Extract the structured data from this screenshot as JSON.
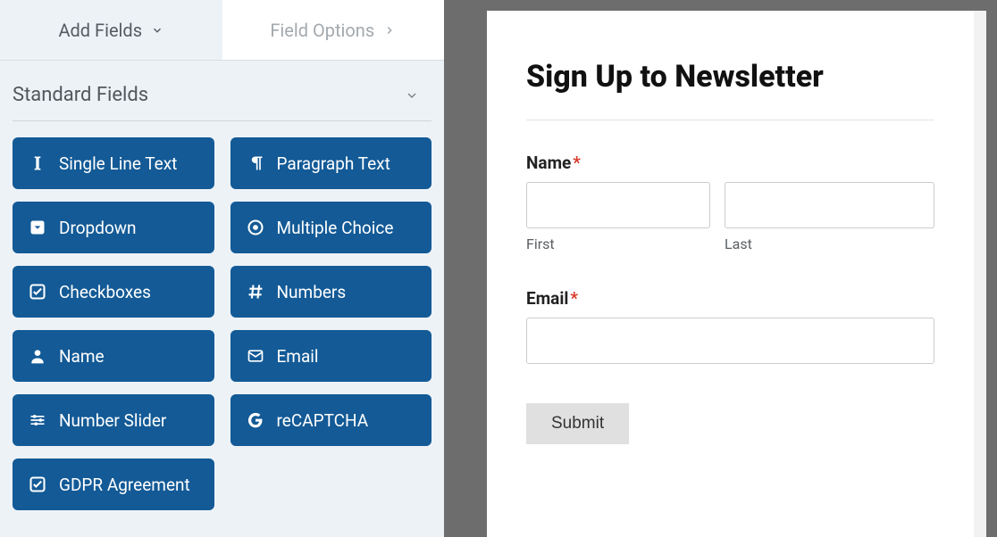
{
  "tabs": {
    "add_fields": "Add Fields",
    "field_options": "Field Options"
  },
  "section": {
    "title": "Standard Fields"
  },
  "fields": [
    {
      "id": "single-line-text",
      "label": "Single Line Text",
      "icon": "text-cursor-icon"
    },
    {
      "id": "paragraph-text",
      "label": "Paragraph Text",
      "icon": "paragraph-icon"
    },
    {
      "id": "dropdown",
      "label": "Dropdown",
      "icon": "caret-square-icon"
    },
    {
      "id": "multiple-choice",
      "label": "Multiple Choice",
      "icon": "radio-dot-icon"
    },
    {
      "id": "checkboxes",
      "label": "Checkboxes",
      "icon": "check-square-icon"
    },
    {
      "id": "numbers",
      "label": "Numbers",
      "icon": "hash-icon"
    },
    {
      "id": "name",
      "label": "Name",
      "icon": "user-icon"
    },
    {
      "id": "email",
      "label": "Email",
      "icon": "envelope-icon"
    },
    {
      "id": "number-slider",
      "label": "Number Slider",
      "icon": "sliders-icon"
    },
    {
      "id": "recaptcha",
      "label": "reCAPTCHA",
      "icon": "google-g-icon"
    },
    {
      "id": "gdpr-agreement",
      "label": "GDPR Agreement",
      "icon": "check-square-icon"
    }
  ],
  "form": {
    "title": "Sign Up to Newsletter",
    "name_label": "Name",
    "first_sub": "First",
    "last_sub": "Last",
    "email_label": "Email",
    "submit_label": "Submit"
  }
}
